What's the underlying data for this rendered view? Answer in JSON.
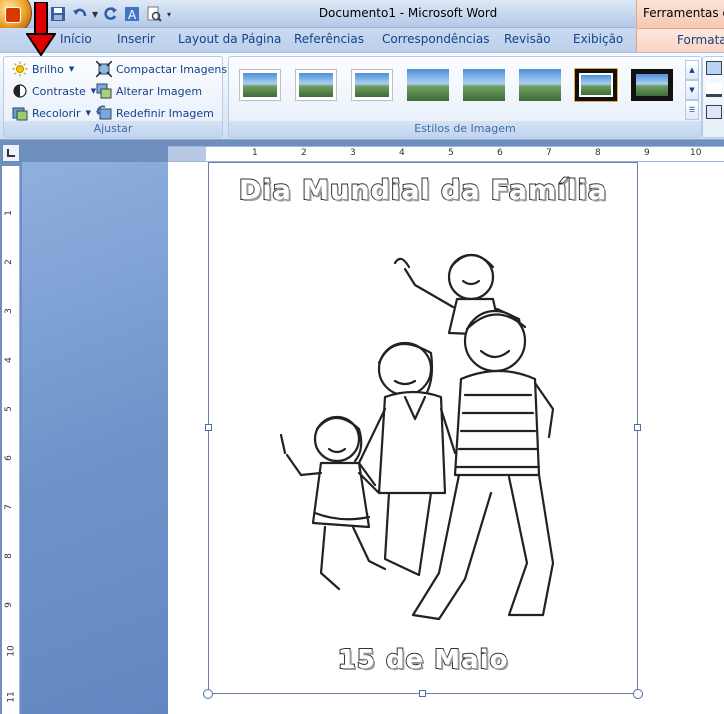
{
  "window": {
    "title": "Documento1 - Microsoft Word",
    "context_tab_title": "Ferramentas de I"
  },
  "tabs": [
    "Início",
    "Inserir",
    "Layout da Página",
    "Referências",
    "Correspondências",
    "Revisão",
    "Exibição"
  ],
  "context_tab": "Formatar",
  "ribbon": {
    "adjust": {
      "label": "Ajustar",
      "brilho": "Brilho",
      "contraste": "Contraste",
      "recolorir": "Recolorir",
      "compactar": "Compactar Imagens",
      "alterar": "Alterar Imagem",
      "redefinir": "Redefinir Imagem"
    },
    "styles": {
      "label": "Estilos de Imagem"
    }
  },
  "ruler": {
    "h_numbers": [
      "1",
      "2",
      "3",
      "4",
      "5",
      "6",
      "7",
      "8",
      "9",
      "10"
    ],
    "v_numbers": [
      "1",
      "2",
      "3",
      "4",
      "5",
      "6",
      "7",
      "8",
      "9",
      "10",
      "11"
    ]
  },
  "document": {
    "title": "Dia Mundial da Família",
    "date": "15 de Maio"
  },
  "colors": {
    "arrow": "#e00000",
    "context_tab": "#f9d3c0",
    "ribbon_text": "#15428b"
  },
  "icons": {
    "brilho": "sun-icon",
    "contraste": "contrast-icon",
    "recolorir": "recolor-icon",
    "compactar": "compress-icon",
    "alterar": "change-picture-icon",
    "redefinir": "reset-picture-icon"
  }
}
